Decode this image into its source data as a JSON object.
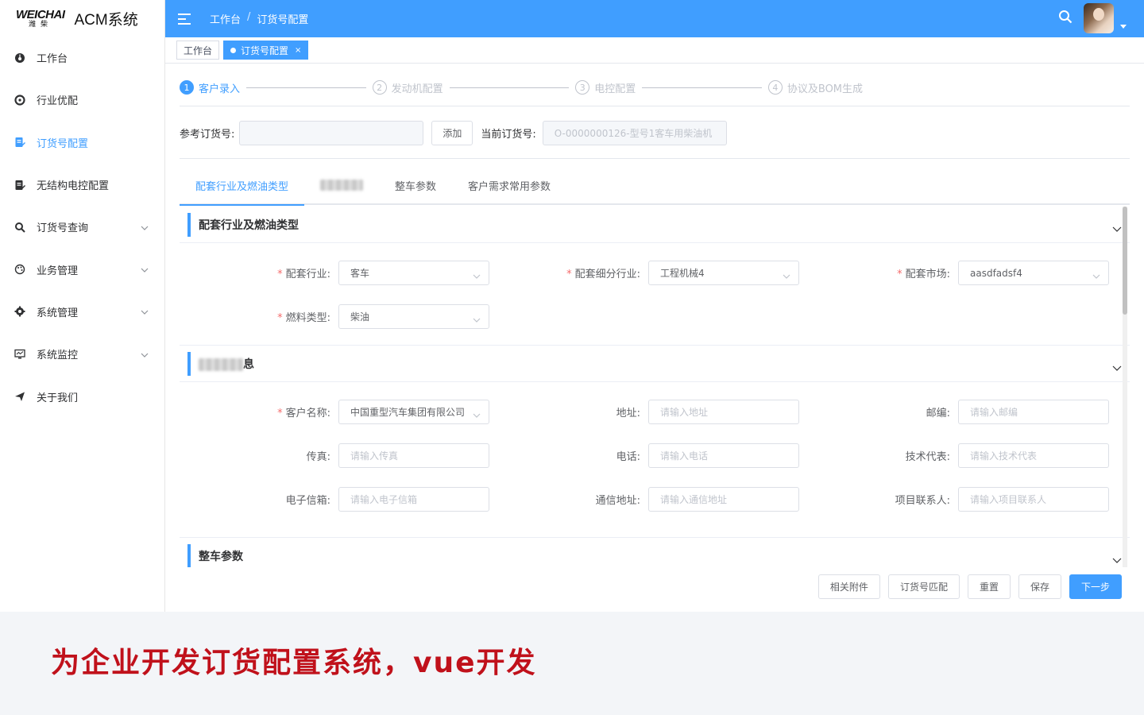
{
  "app": {
    "logo_en": "WEICHAI",
    "logo_cn": "潍柴",
    "title": "ACM系统"
  },
  "sidebar": {
    "items": [
      {
        "label": "工作台",
        "icon": "dashboard-icon",
        "active": false,
        "expandable": false
      },
      {
        "label": "行业优配",
        "icon": "aperture-icon",
        "active": false,
        "expandable": false
      },
      {
        "label": "订货号配置",
        "icon": "document-edit-icon",
        "active": true,
        "expandable": false
      },
      {
        "label": "无结构电控配置",
        "icon": "document-edit-icon",
        "active": false,
        "expandable": false
      },
      {
        "label": "订货号查询",
        "icon": "search-icon",
        "active": false,
        "expandable": true
      },
      {
        "label": "业务管理",
        "icon": "palette-icon",
        "active": false,
        "expandable": true
      },
      {
        "label": "系统管理",
        "icon": "gear-icon",
        "active": false,
        "expandable": true
      },
      {
        "label": "系统监控",
        "icon": "monitor-icon",
        "active": false,
        "expandable": true
      },
      {
        "label": "关于我们",
        "icon": "send-icon",
        "active": false,
        "expandable": false
      }
    ]
  },
  "header": {
    "breadcrumb_home": "工作台",
    "breadcrumb_sep": "/",
    "breadcrumb_current": "订货号配置"
  },
  "tags": {
    "home": "工作台",
    "current": "订货号配置",
    "close": "×"
  },
  "steps": [
    {
      "num": "1",
      "label": "客户录入"
    },
    {
      "num": "2",
      "label": "发动机配置"
    },
    {
      "num": "3",
      "label": "电控配置"
    },
    {
      "num": "4",
      "label": "协议及BOM生成"
    }
  ],
  "reference": {
    "label": "参考订货号:",
    "value": "",
    "add_button": "添加",
    "current_label": "当前订货号:",
    "current_value": "O-0000000126-型号1客车用柴油机"
  },
  "tabs": [
    {
      "label": "配套行业及燃油类型",
      "active": true
    },
    {
      "label": "",
      "active": false,
      "blurred": true
    },
    {
      "label": "整车参数",
      "active": false
    },
    {
      "label": "客户需求常用参数",
      "active": false
    }
  ],
  "section1": {
    "title": "配套行业及燃油类型",
    "fields": [
      {
        "label": "配套行业:",
        "required": true,
        "value": "客车",
        "select": true
      },
      {
        "label": "配套细分行业:",
        "required": true,
        "value": "工程机械4",
        "select": true
      },
      {
        "label": "配套市场:",
        "required": true,
        "value": "aasdfadsf4",
        "select": true
      },
      {
        "label": "燃料类型:",
        "required": true,
        "value": "柴油",
        "select": true
      }
    ]
  },
  "section2": {
    "title_suffix": "息",
    "fields": [
      {
        "label": "客户名称:",
        "required": true,
        "value": "中国重型汽车集团有限公司",
        "select": true
      },
      {
        "label": "地址:",
        "required": false,
        "placeholder": "请输入地址"
      },
      {
        "label": "邮编:",
        "required": false,
        "placeholder": "请输入邮编"
      },
      {
        "label": "传真:",
        "required": false,
        "placeholder": "请输入传真"
      },
      {
        "label": "电话:",
        "required": false,
        "placeholder": "请输入电话"
      },
      {
        "label": "技术代表:",
        "required": false,
        "placeholder": "请输入技术代表"
      },
      {
        "label": "电子信箱:",
        "required": false,
        "placeholder": "请输入电子信箱"
      },
      {
        "label": "通信地址:",
        "required": false,
        "placeholder": "请输入通信地址"
      },
      {
        "label": "项目联系人:",
        "required": false,
        "placeholder": "请输入项目联系人"
      }
    ]
  },
  "section3": {
    "title": "整车参数"
  },
  "footer": {
    "attachments": "相关附件",
    "match": "订货号匹配",
    "reset": "重置",
    "save": "保存",
    "next": "下一步"
  },
  "caption": "为企业开发订货配置系统，vue开发",
  "colors": {
    "primary": "#409eff",
    "caption": "#c0111b",
    "required": "#f56c6c"
  }
}
